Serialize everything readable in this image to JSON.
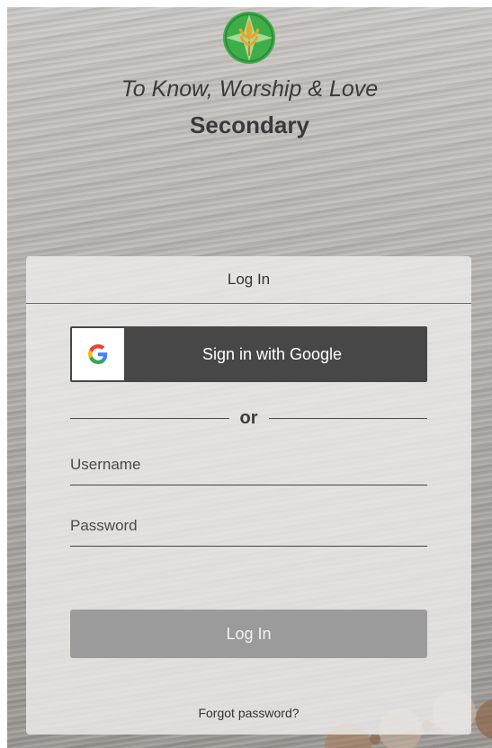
{
  "header": {
    "tagline": "To Know, Worship & Love",
    "school_level": "Secondary",
    "logo_icon": "wheat-logo-icon"
  },
  "login_card": {
    "title": "Log In",
    "google_button_label": "Sign in with Google",
    "google_icon": "google-g-icon",
    "divider_text": "or",
    "username_placeholder": "Username",
    "password_placeholder": "Password",
    "submit_label": "Log In",
    "forgot_link": "Forgot password?"
  },
  "colors": {
    "google_button_bg": "#474747",
    "submit_button_bg": "#9b9b9b",
    "logo_green": "#3fae49",
    "logo_wheat": "#e8a52a"
  }
}
